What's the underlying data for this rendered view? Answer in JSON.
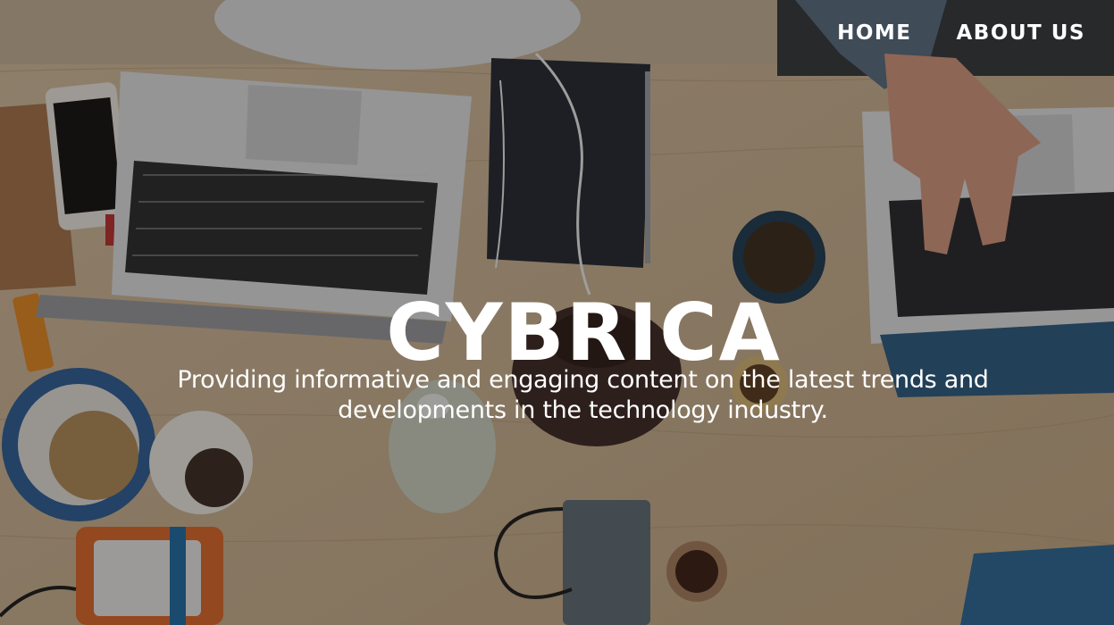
{
  "nav": {
    "items": [
      {
        "label": "HOME"
      },
      {
        "label": "ABOUT US"
      }
    ]
  },
  "hero": {
    "title": "CYBRICA",
    "tagline": "Providing informative and engaging content on the latest trends and developments in the technology industry."
  },
  "colors": {
    "text": "#ffffff",
    "overlay": "rgba(20,18,16,0.38)",
    "desk": "#c9ad8c"
  }
}
